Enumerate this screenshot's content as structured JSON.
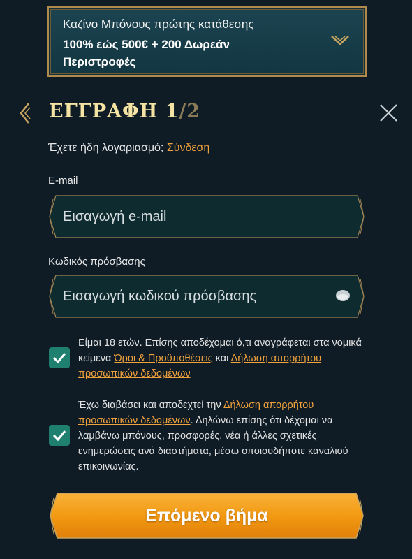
{
  "bonus": {
    "title": "Καζίνο Μπόνους πρώτης κατάθεσης",
    "text": "100% εώς 500€ + 200 Δωρεάν Περιστροφές"
  },
  "header": {
    "title": "ΕΓΓΡΑΦΗ 1",
    "step_total": "/2"
  },
  "login": {
    "prompt": "Έχετε ήδη λογαριασμό;",
    "link": "Σύνδεση"
  },
  "email": {
    "label": "E-mail",
    "placeholder": "Εισαγωγή e-mail",
    "value": ""
  },
  "password": {
    "label": "Κωδικός πρόσβασης",
    "placeholder": "Εισαγωγή κωδικού πρόσβασης",
    "value": ""
  },
  "terms": {
    "checked": true,
    "text_before": "Είμαι 18 ετών. Επίσης αποδέχομαι ό,τι αναγράφεται στα νομικά κείμενα ",
    "terms_link": "Όροι & Προϋποθέσεις",
    "text_middle": " και ",
    "privacy_link": "Δήλωση απορρήτου προσωπικών δεδομένων"
  },
  "marketing": {
    "checked": true,
    "text_before": "Έχω διαβάσει και αποδεχτεί την ",
    "privacy_link": "Δήλωση απορρήτου προσωπικών δεδομένων",
    "text_after": ". Δηλώνω επίσης ότι δέχομαι να λαμβάνω μπόνους, προσφορές, νέα ή άλλες σχετικές ενημερώσεις ανά διαστήματα, μέσω οποιουδήποτε καναλιού επικοινωνίας."
  },
  "next_button": {
    "label": "Επόμενο βήμα"
  },
  "colors": {
    "background": "#0f1c26",
    "field": "#0e2b30",
    "gold": "#b08a4c",
    "link": "#f0a23c",
    "checkbox": "#1f8070",
    "button": "#f09a12"
  },
  "icons": {
    "bonus_toggle": "chevron-down-icon",
    "back": "chevron-left-icon",
    "close": "close-icon",
    "password_toggle": "eye-icon",
    "checkmark": "check-icon"
  }
}
